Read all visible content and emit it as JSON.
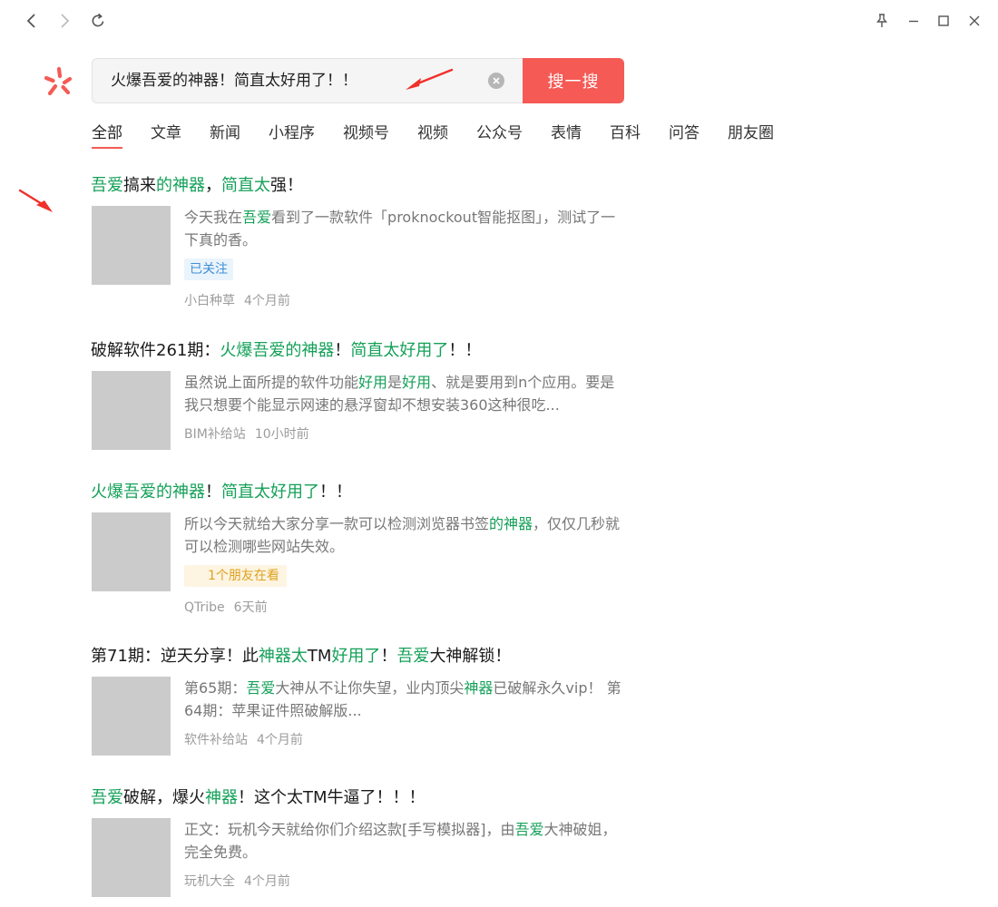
{
  "titlebar": {
    "back_icon": "chevron-left-icon",
    "forward_icon": "chevron-right-icon",
    "refresh_icon": "refresh-icon",
    "pin_icon": "pin-icon",
    "minimize_icon": "minimize-icon",
    "maximize_icon": "maximize-icon",
    "close_icon": "close-icon"
  },
  "brand": {
    "logo_icon": "wechat-search-logo-icon",
    "color": "#f55a55"
  },
  "search": {
    "query": "火爆吾爱的神器！简直太好用了！！",
    "clear_icon": "clear-icon",
    "button_label": "搜一搜"
  },
  "tabs": [
    {
      "label": "全部",
      "active": true
    },
    {
      "label": "文章"
    },
    {
      "label": "新闻"
    },
    {
      "label": "小程序"
    },
    {
      "label": "视频号"
    },
    {
      "label": "视频"
    },
    {
      "label": "公众号"
    },
    {
      "label": "表情"
    },
    {
      "label": "百科"
    },
    {
      "label": "问答"
    },
    {
      "label": "朋友圈"
    }
  ],
  "colors": {
    "highlight": "#14a058",
    "accent": "#f55a55",
    "annotation_arrow": "#f0302a"
  },
  "results": [
    {
      "title": [
        {
          "t": "吾爱",
          "hl": true
        },
        {
          "t": "搞来"
        },
        {
          "t": "的神器",
          "hl": true
        },
        {
          "t": "，"
        },
        {
          "t": "简直太",
          "hl": true
        },
        {
          "t": "强！"
        }
      ],
      "snippet": [
        {
          "t": "今天我在"
        },
        {
          "t": "吾爱",
          "hl": true
        },
        {
          "t": "看到了一款软件「proknockout智能抠图」，测试了一下真的香。"
        }
      ],
      "tag": {
        "label": "已关注",
        "kind": "follow"
      },
      "source": "小白种草",
      "time": "4个月前"
    },
    {
      "title": [
        {
          "t": "破解软件261期："
        },
        {
          "t": "火爆吾爱的神器",
          "hl": true
        },
        {
          "t": "！"
        },
        {
          "t": "简直太好用了",
          "hl": true
        },
        {
          "t": "！！"
        }
      ],
      "snippet": [
        {
          "t": "虽然说上面所提的软件功能"
        },
        {
          "t": "好用",
          "hl": true
        },
        {
          "t": "是"
        },
        {
          "t": "好用",
          "hl": true
        },
        {
          "t": "、就是要用到n个应用。要是我只想要个能显示网速的悬浮窗却不想安装360这种很吃..."
        }
      ],
      "source": "BIM补给站",
      "time": "10小时前"
    },
    {
      "title": [
        {
          "t": "火爆吾爱的神器",
          "hl": true
        },
        {
          "t": "！"
        },
        {
          "t": "简直太好用了",
          "hl": true
        },
        {
          "t": "！！"
        }
      ],
      "snippet": [
        {
          "t": "所以今天就给大家分享一款可以检测浏览器书签"
        },
        {
          "t": "的神器",
          "hl": true
        },
        {
          "t": "，仅仅几秒就可以检测哪些网站失效。"
        }
      ],
      "tag": {
        "label": "1个朋友在看",
        "kind": "friends"
      },
      "source": "QTribe",
      "time": "6天前"
    },
    {
      "title": [
        {
          "t": "第71期：逆天分享！此"
        },
        {
          "t": "神器太",
          "hl": true
        },
        {
          "t": "TM"
        },
        {
          "t": "好用了",
          "hl": true
        },
        {
          "t": "！"
        },
        {
          "t": "吾爱",
          "hl": true
        },
        {
          "t": "大神解锁！"
        }
      ],
      "snippet": [
        {
          "t": "第65期："
        },
        {
          "t": "吾爱",
          "hl": true
        },
        {
          "t": "大神从不让你失望，业内顶尖"
        },
        {
          "t": "神器",
          "hl": true
        },
        {
          "t": "已破解永久vip！ 第64期：苹果证件照破解版..."
        }
      ],
      "source": "软件补给站",
      "time": "4个月前"
    },
    {
      "title": [
        {
          "t": "吾爱",
          "hl": true
        },
        {
          "t": "破解，爆火"
        },
        {
          "t": "神器",
          "hl": true
        },
        {
          "t": "！这个太TM牛逼了！！！"
        }
      ],
      "snippet": [
        {
          "t": "正文：玩机今天就给你们介绍这款[手写模拟器]，由"
        },
        {
          "t": "吾爱",
          "hl": true
        },
        {
          "t": "大神破姐，完全免费。"
        }
      ],
      "source": "玩机大全",
      "time": "4个月前"
    }
  ]
}
